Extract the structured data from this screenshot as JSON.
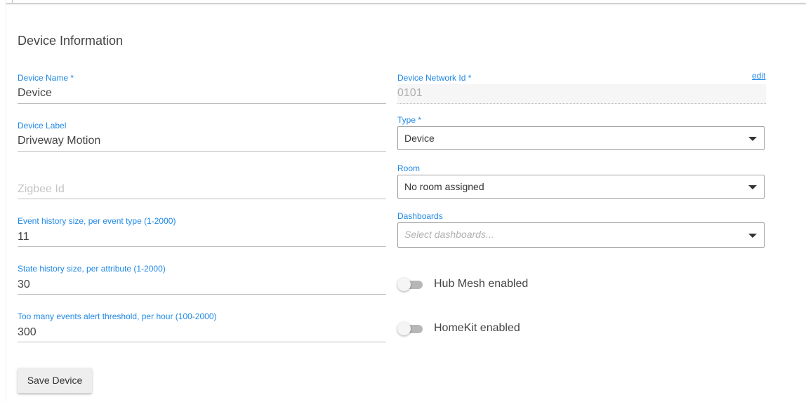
{
  "section_title": "Device Information",
  "left": {
    "device_name": {
      "label": "Device Name *",
      "value": "Device"
    },
    "device_label": {
      "label": "Device Label",
      "value": "Driveway Motion"
    },
    "zigbee_id": {
      "placeholder": "Zigbee Id"
    },
    "event_history": {
      "label": "Event history size, per event type (1-2000)",
      "value": "11"
    },
    "state_history": {
      "label": "State history size, per attribute (1-2000)",
      "value": "30"
    },
    "alert_threshold": {
      "label": "Too many events alert threshold, per hour (100-2000)",
      "value": "300"
    }
  },
  "right": {
    "network_id": {
      "label": "Device Network Id *",
      "value": "0101",
      "edit_label": "edit"
    },
    "type": {
      "label": "Type *",
      "value": "Device"
    },
    "room": {
      "label": "Room",
      "value": "No room assigned"
    },
    "dashboards": {
      "label": "Dashboards",
      "placeholder": "Select dashboards..."
    },
    "hub_mesh": {
      "label": "Hub Mesh enabled",
      "enabled": false
    },
    "homekit": {
      "label": "HomeKit enabled",
      "enabled": false
    }
  },
  "save_button": "Save Device",
  "icons": {
    "dropdown": "chevron-down-icon"
  },
  "colors": {
    "accent": "#1e88e5",
    "toggle_off": "#b7b7b7"
  }
}
